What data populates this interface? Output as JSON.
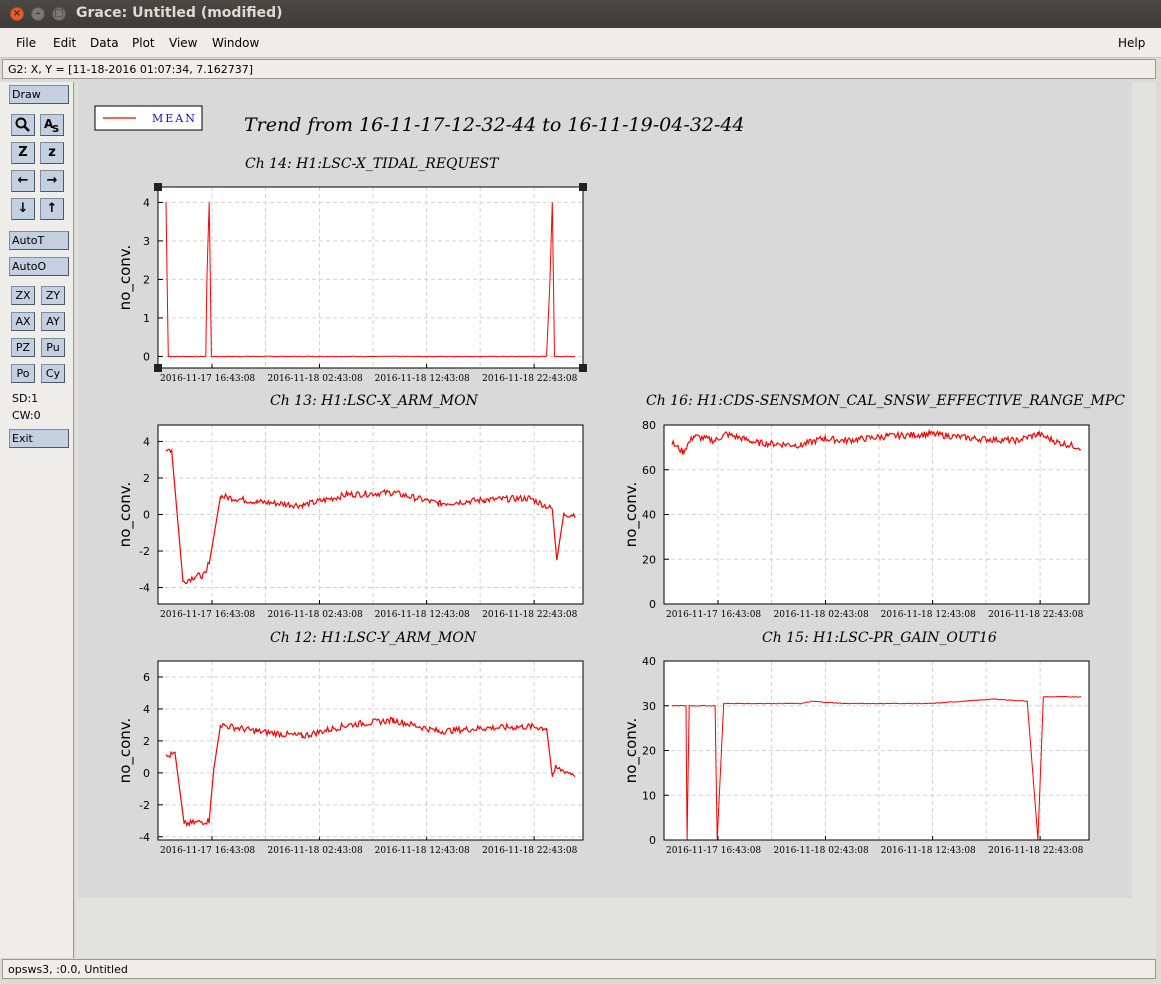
{
  "window": {
    "title": "Grace: Untitled (modified)",
    "close_glyph": "×",
    "min_glyph": "–",
    "max_glyph": "□"
  },
  "menu": {
    "file": "File",
    "edit": "Edit",
    "data": "Data",
    "plot": "Plot",
    "view": "View",
    "window": "Window",
    "help": "Help"
  },
  "locator": "G2: X, Y = [11-18-2016 01:07:34, 7.162737]",
  "toolbar": {
    "draw": "Draw",
    "zoom_icon": "magnifier-icon",
    "text_icon": "text-icon",
    "autot": "AutoT",
    "autoo": "AutoO",
    "zx": "ZX",
    "zy": "ZY",
    "ax": "AX",
    "ay": "AY",
    "pz": "PZ",
    "pu": "Pu",
    "po": "Po",
    "cy": "Cy",
    "sd": "SD:1",
    "cw": "CW:0",
    "exit": "Exit",
    "z_big": "Z",
    "z_small": "z",
    "left_arrow": "←",
    "right_arrow": "→",
    "down_arrow": "↓",
    "up_arrow": "↑"
  },
  "status": "opsws3, :0.0, Untitled",
  "figure": {
    "title": "Trend from 16-11-17-12-32-44 to 16-11-19-04-32-44",
    "legend": "MEAN",
    "line_color": "#ff0000"
  },
  "chart_data": [
    {
      "type": "line",
      "title": "Ch 14: H1:LSC-X_TIDAL_REQUEST",
      "ylabel": "no_conv.",
      "ylim": [
        -0.3,
        4.4
      ],
      "yticks": [
        "0",
        "1",
        "2",
        "3",
        "4"
      ],
      "xticks": [
        "2016-11-17 16:43:08",
        "2016-11-18 02:43:08",
        "2016-11-18 12:43:08",
        "2016-11-18 22:43:08"
      ],
      "series": [
        {
          "values": [
            [
              0.0,
              4
            ],
            [
              0.2,
              0
            ],
            [
              3.5,
              0
            ],
            [
              3.6,
              2
            ],
            [
              3.8,
              4
            ],
            [
              4.0,
              0
            ],
            [
              33.5,
              0
            ],
            [
              33.8,
              2
            ],
            [
              34.0,
              4
            ],
            [
              34.2,
              0
            ],
            [
              36.0,
              0
            ]
          ]
        }
      ]
    },
    {
      "type": "line",
      "title": "Ch 13: H1:LSC-X_ARM_MON",
      "ylabel": "no_conv.",
      "ylim": [
        -4.9,
        4.9
      ],
      "yticks": [
        "-4",
        "-2",
        "0",
        "2",
        "4"
      ],
      "xticks": [
        "2016-11-17 16:43:08",
        "2016-11-18 02:43:08",
        "2016-11-18 12:43:08",
        "2016-11-18 22:43:08"
      ],
      "series": [
        {
          "values": [
            [
              0.0,
              3.6
            ],
            [
              0.5,
              3.5
            ],
            [
              1.5,
              -3.7
            ],
            [
              2.5,
              -3.4
            ],
            [
              3.5,
              -3.3
            ],
            [
              4.0,
              -2.0
            ],
            [
              4.8,
              1.0
            ],
            [
              8,
              0.7
            ],
            [
              12,
              0.5
            ],
            [
              16,
              1.1
            ],
            [
              20,
              1.2
            ],
            [
              24,
              0.6
            ],
            [
              28,
              0.8
            ],
            [
              32,
              0.9
            ],
            [
              34.0,
              0.3
            ],
            [
              34.4,
              -2.5
            ],
            [
              35.0,
              0.0
            ],
            [
              36.0,
              0.0
            ]
          ]
        }
      ]
    },
    {
      "type": "line",
      "title": "Ch 16: H1:CDS-SENSMON_CAL_SNSW_EFFECTIVE_RANGE_MPC",
      "ylabel": "no_conv.",
      "ylim": [
        0,
        80
      ],
      "yticks": [
        "0",
        "20",
        "40",
        "60",
        "80"
      ],
      "xticks": [
        "2016-11-17 16:43:08",
        "2016-11-18 02:43:08",
        "2016-11-18 12:43:08",
        "2016-11-18 22:43:08"
      ],
      "series": [
        {
          "values": [
            [
              0.0,
              72
            ],
            [
              1.0,
              68
            ],
            [
              2.0,
              75
            ],
            [
              4.0,
              73
            ],
            [
              5.0,
              76
            ],
            [
              8.0,
              72
            ],
            [
              12.0,
              71
            ],
            [
              14.0,
              74
            ],
            [
              16.0,
              73
            ],
            [
              20.0,
              75
            ],
            [
              24.0,
              76
            ],
            [
              28.0,
              74
            ],
            [
              32.0,
              73
            ],
            [
              34.0,
              76
            ],
            [
              36.0,
              72
            ],
            [
              38.0,
              70
            ]
          ]
        }
      ]
    },
    {
      "type": "line",
      "title": "Ch 12: H1:LSC-Y_ARM_MON",
      "ylabel": "no_conv.",
      "ylim": [
        -4.2,
        7.0
      ],
      "yticks": [
        "-4",
        "-2",
        "0",
        "2",
        "4",
        "6"
      ],
      "xticks": [
        "2016-11-17 16:43:08",
        "2016-11-18 02:43:08",
        "2016-11-18 12:43:08",
        "2016-11-18 22:43:08"
      ],
      "series": [
        {
          "values": [
            [
              0.0,
              1.0
            ],
            [
              0.8,
              1.2
            ],
            [
              1.6,
              -3.2
            ],
            [
              3.8,
              -3.0
            ],
            [
              4.2,
              0.2
            ],
            [
              4.8,
              3.0
            ],
            [
              8,
              2.6
            ],
            [
              12,
              2.3
            ],
            [
              16,
              3.0
            ],
            [
              20,
              3.3
            ],
            [
              24,
              2.6
            ],
            [
              28,
              2.8
            ],
            [
              32,
              2.9
            ],
            [
              33.5,
              2.8
            ],
            [
              34.0,
              -0.2
            ],
            [
              34.3,
              0.3
            ],
            [
              36.0,
              -0.1
            ]
          ]
        }
      ]
    },
    {
      "type": "line",
      "title": "Ch 15: H1:LSC-PR_GAIN_OUT16",
      "ylabel": "no_conv.",
      "ylim": [
        0,
        40
      ],
      "yticks": [
        "0",
        "10",
        "20",
        "30",
        "40"
      ],
      "xticks": [
        "2016-11-17 16:43:08",
        "2016-11-18 02:43:08",
        "2016-11-18 12:43:08",
        "2016-11-18 22:43:08"
      ],
      "series": [
        {
          "values": [
            [
              0.0,
              30
            ],
            [
              1.3,
              30
            ],
            [
              1.4,
              0
            ],
            [
              1.6,
              30
            ],
            [
              4.0,
              30
            ],
            [
              4.2,
              0
            ],
            [
              4.8,
              30.5
            ],
            [
              12,
              30.5
            ],
            [
              13,
              31
            ],
            [
              16,
              30.5
            ],
            [
              24,
              30.5
            ],
            [
              30,
              31.5
            ],
            [
              33,
              31
            ],
            [
              34.0,
              0
            ],
            [
              34.5,
              32
            ],
            [
              38.0,
              32
            ]
          ]
        }
      ]
    }
  ]
}
